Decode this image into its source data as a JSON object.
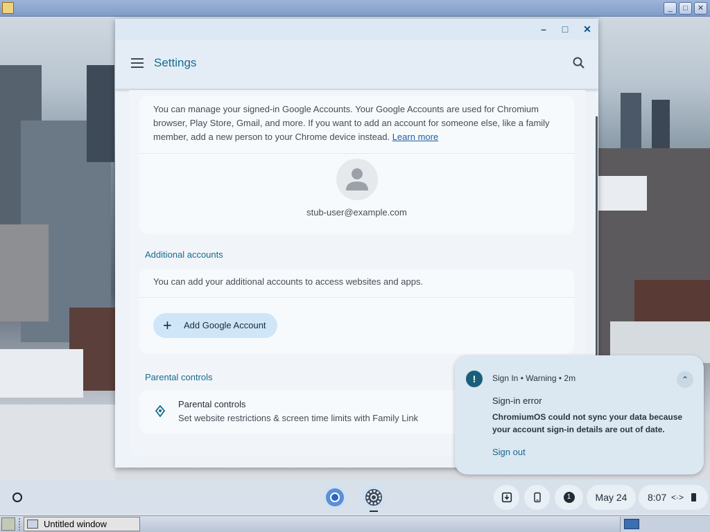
{
  "settings": {
    "title": "Settings",
    "accounts_description": "You can manage your signed-in Google Accounts. Your Google Accounts are used for Chromium browser, Play Store, Gmail, and more. If you want to add an account for someone else, like a family member, add a new person to your Chrome device instead.",
    "learn_more": "Learn more",
    "user_email": "stub-user@example.com",
    "additional_accounts": {
      "title": "Additional accounts",
      "description": "You can add your additional accounts to access websites and apps.",
      "add_button": "Add Google Account"
    },
    "parental_controls": {
      "section_title": "Parental controls",
      "item_title": "Parental controls",
      "item_subtitle": "Set website restrictions & screen time limits with Family Link"
    }
  },
  "notification": {
    "source": "Sign In",
    "severity": "Warning",
    "age": "2m",
    "title": "Sign-in error",
    "body": "ChromiumOS could not sync your data because your account sign-in details are out of date.",
    "action": "Sign out"
  },
  "shelf": {
    "notification_count": "1",
    "date": "May 24",
    "time": "8:07"
  },
  "host_taskbar": {
    "task_title": "Untitled window"
  },
  "colors": {
    "accent": "#176b8d",
    "add_button_bg": "#cfe6f8",
    "notification_icon": "#1a5f7a"
  }
}
